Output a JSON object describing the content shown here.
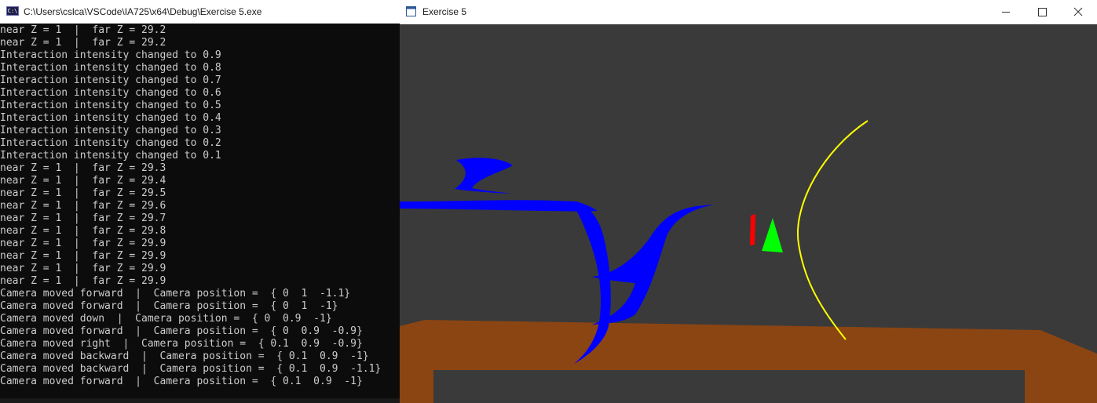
{
  "console": {
    "title": "C:\\Users\\cslca\\VSCode\\IA725\\x64\\Debug\\Exercise 5.exe",
    "icon": "console-app-icon",
    "icon_glyph": "C:\\",
    "lines": [
      "near Z = 1  |  far Z = 29.2",
      "near Z = 1  |  far Z = 29.2",
      "Interaction intensity changed to 0.9",
      "Interaction intensity changed to 0.8",
      "Interaction intensity changed to 0.7",
      "Interaction intensity changed to 0.6",
      "Interaction intensity changed to 0.5",
      "Interaction intensity changed to 0.4",
      "Interaction intensity changed to 0.3",
      "Interaction intensity changed to 0.2",
      "Interaction intensity changed to 0.1",
      "near Z = 1  |  far Z = 29.3",
      "near Z = 1  |  far Z = 29.4",
      "near Z = 1  |  far Z = 29.5",
      "near Z = 1  |  far Z = 29.6",
      "near Z = 1  |  far Z = 29.7",
      "near Z = 1  |  far Z = 29.8",
      "near Z = 1  |  far Z = 29.9",
      "near Z = 1  |  far Z = 29.9",
      "near Z = 1  |  far Z = 29.9",
      "near Z = 1  |  far Z = 29.9",
      "Camera moved forward  |  Camera position =  { 0  1  -1.1}",
      "Camera moved forward  |  Camera position =  { 0  1  -1}",
      "Camera moved down  |  Camera position =  { 0  0.9  -1}",
      "Camera moved forward  |  Camera position =  { 0  0.9  -0.9}",
      "Camera moved right  |  Camera position =  { 0.1  0.9  -0.9}",
      "Camera moved backward  |  Camera position =  { 0.1  0.9  -1}",
      "Camera moved backward  |  Camera position =  { 0.1  0.9  -1.1}",
      "Camera moved forward  |  Camera position =  { 0.1  0.9  -1}"
    ]
  },
  "gl_window": {
    "title": "Exercise 5",
    "icon": "opengl-window-icon",
    "buttons": [
      "minimize",
      "maximize",
      "close"
    ],
    "scene": {
      "background_color": "#3a3a3a",
      "table_color": "#8b4513",
      "ribbon_color": "#0000ff",
      "bar_color": "#ff0000",
      "cone_color": "#00ff00",
      "arc_color": "#ffff00"
    }
  }
}
